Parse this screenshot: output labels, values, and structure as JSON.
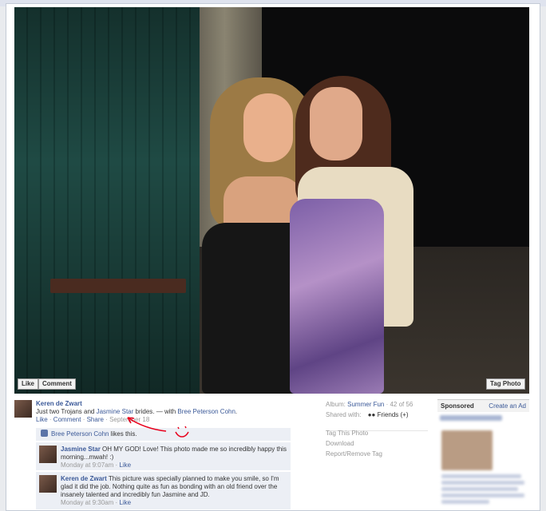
{
  "photo": {
    "like_label": "Like",
    "comment_label": "Comment",
    "tag_label": "Tag Photo"
  },
  "post": {
    "author": "Keren de Zwart",
    "caption_prefix": "Just two Trojans and ",
    "caption_tag": "Jasmine Star",
    "caption_mid": " brides. — with ",
    "caption_with": "Bree Peterson Cohn",
    "caption_end": ".",
    "action_like": "Like",
    "action_comment": "Comment",
    "action_share": "Share",
    "date": "September 18",
    "sep": " · "
  },
  "likes": {
    "name": "Bree Peterson Cohn",
    "suffix": " likes this."
  },
  "comments": [
    {
      "name": "Jasmine Star",
      "text": " OH MY GOD! Love! This photo made me so incredibly happy this morning...mwah! :)",
      "time": "Monday at 9:07am",
      "like": "Like"
    },
    {
      "name": "Keren de Zwart",
      "text": " This picture was specially planned to make you smile, so I'm glad it did the job. Nothing quite as fun as bonding with an old friend over the insanely talented and incredibly fun Jasmine and JD.",
      "time": "Monday at 9:30am",
      "like": "Like"
    }
  ],
  "album": {
    "label": "Album: ",
    "name": "Summer Fun",
    "count": " · 42 of 56",
    "shared_label": "Shared with:",
    "shared_value": "Friends (+)"
  },
  "photo_actions": [
    "Tag This Photo",
    "Download",
    "Report/Remove Tag"
  ],
  "sponsored": {
    "title": "Sponsored",
    "create": "Create an Ad"
  },
  "colors": {
    "link": "#3b5998",
    "annotation": "#e8001c",
    "comment_bg": "#eceff5"
  }
}
